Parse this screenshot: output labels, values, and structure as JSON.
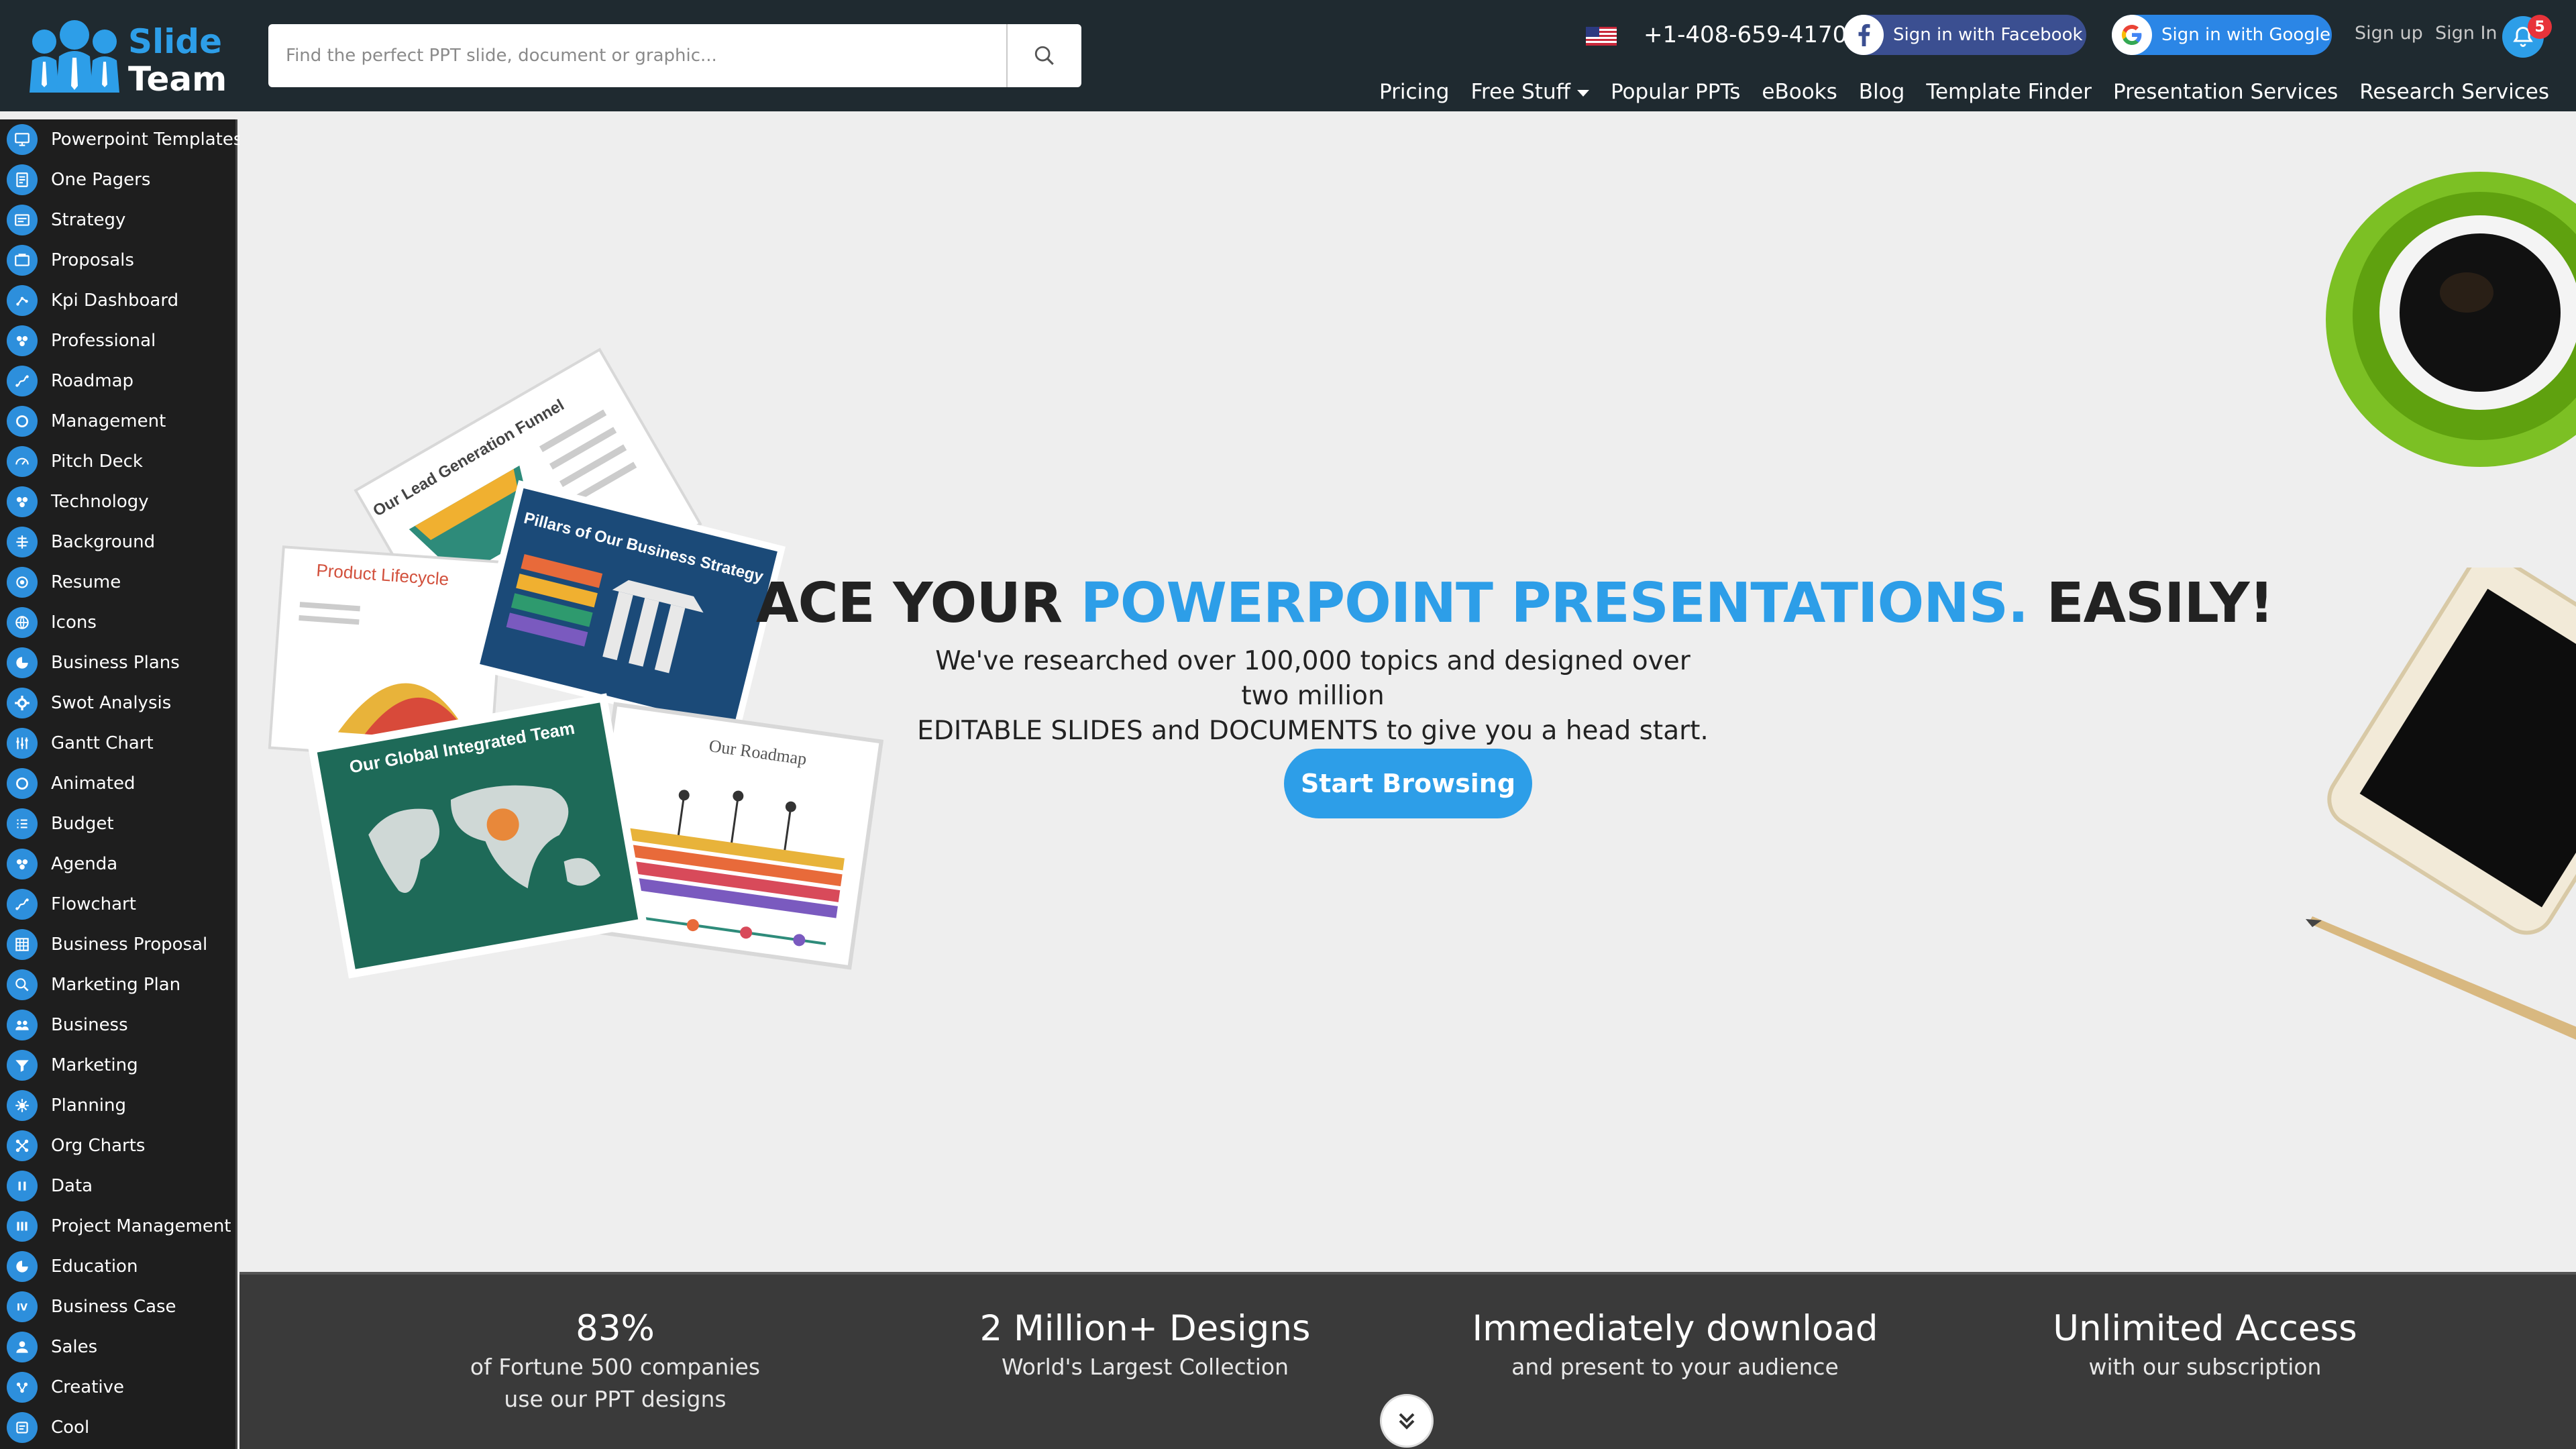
{
  "header": {
    "logo": {
      "line1": "Slide",
      "line2": "Team"
    },
    "search": {
      "placeholder": "Find the perfect PPT slide, document or graphic..."
    },
    "phone": "+1-408-659-4170",
    "facebook_label": "Sign in with Facebook",
    "google_label": "Sign in with Google",
    "signup_label": "Sign up",
    "signin_label": "Sign In",
    "notification_count": "5",
    "nav": [
      {
        "label": "Pricing"
      },
      {
        "label": "Free Stuff"
      },
      {
        "label": "Popular PPTs"
      },
      {
        "label": "eBooks"
      },
      {
        "label": "Blog"
      },
      {
        "label": "Template Finder"
      },
      {
        "label": "Presentation Services"
      },
      {
        "label": "Research Services"
      }
    ]
  },
  "sidebar": {
    "items": [
      {
        "label": "Powerpoint Templates"
      },
      {
        "label": "One Pagers"
      },
      {
        "label": "Strategy"
      },
      {
        "label": "Proposals"
      },
      {
        "label": "Kpi Dashboard"
      },
      {
        "label": "Professional"
      },
      {
        "label": "Roadmap"
      },
      {
        "label": "Management"
      },
      {
        "label": "Pitch Deck"
      },
      {
        "label": "Technology"
      },
      {
        "label": "Background"
      },
      {
        "label": "Resume"
      },
      {
        "label": "Icons"
      },
      {
        "label": "Business Plans"
      },
      {
        "label": "Swot Analysis"
      },
      {
        "label": "Gantt Chart"
      },
      {
        "label": "Animated"
      },
      {
        "label": "Budget"
      },
      {
        "label": "Agenda"
      },
      {
        "label": "Flowchart"
      },
      {
        "label": "Business Proposal"
      },
      {
        "label": "Marketing Plan"
      },
      {
        "label": "Business"
      },
      {
        "label": "Marketing"
      },
      {
        "label": "Planning"
      },
      {
        "label": "Org Charts"
      },
      {
        "label": "Data"
      },
      {
        "label": "Project Management"
      },
      {
        "label": "Education"
      },
      {
        "label": "Business Case"
      },
      {
        "label": "Sales"
      },
      {
        "label": "Creative"
      },
      {
        "label": "Cool"
      }
    ]
  },
  "hero": {
    "title_part1": "ACE YOUR ",
    "title_accent": "POWERPOINT PRESENTATIONS.",
    "title_part2": " EASILY!",
    "subtitle_line1": "We've researched over 100,000 topics and designed over two million",
    "subtitle_line2": "EDITABLE SLIDES and DOCUMENTS to give you a head start.",
    "cta_label": "Start Browsing",
    "slide_titles": [
      "Our Lead Generation Funnel",
      "Product Lifecycle",
      "Pillars of Our Business Strategy",
      "Our Global Integrated Team",
      "Our Roadmap"
    ]
  },
  "stats": [
    {
      "title": "83%",
      "desc_line1": "of Fortune 500 companies",
      "desc_line2": "use our PPT designs"
    },
    {
      "title": "2 Million+ Designs",
      "desc_line1": "World's Largest Collection",
      "desc_line2": ""
    },
    {
      "title": "Immediately download",
      "desc_line1": "and present to your audience",
      "desc_line2": ""
    },
    {
      "title": "Unlimited Access",
      "desc_line1": "with our subscription",
      "desc_line2": ""
    }
  ],
  "colors": {
    "accent": "#2d9ee8",
    "header_bg": "#1f2a30",
    "sidebar_bg": "#1e1e1e",
    "stats_bg": "#3a3a3a",
    "facebook": "#3b4f91",
    "google": "#2b86e6",
    "badge": "#e8333a"
  },
  "icons": {
    "search": "search-icon",
    "bell": "bell-icon",
    "facebook": "facebook-icon",
    "google": "google-icon",
    "scroll": "chevron-double-down-icon"
  }
}
